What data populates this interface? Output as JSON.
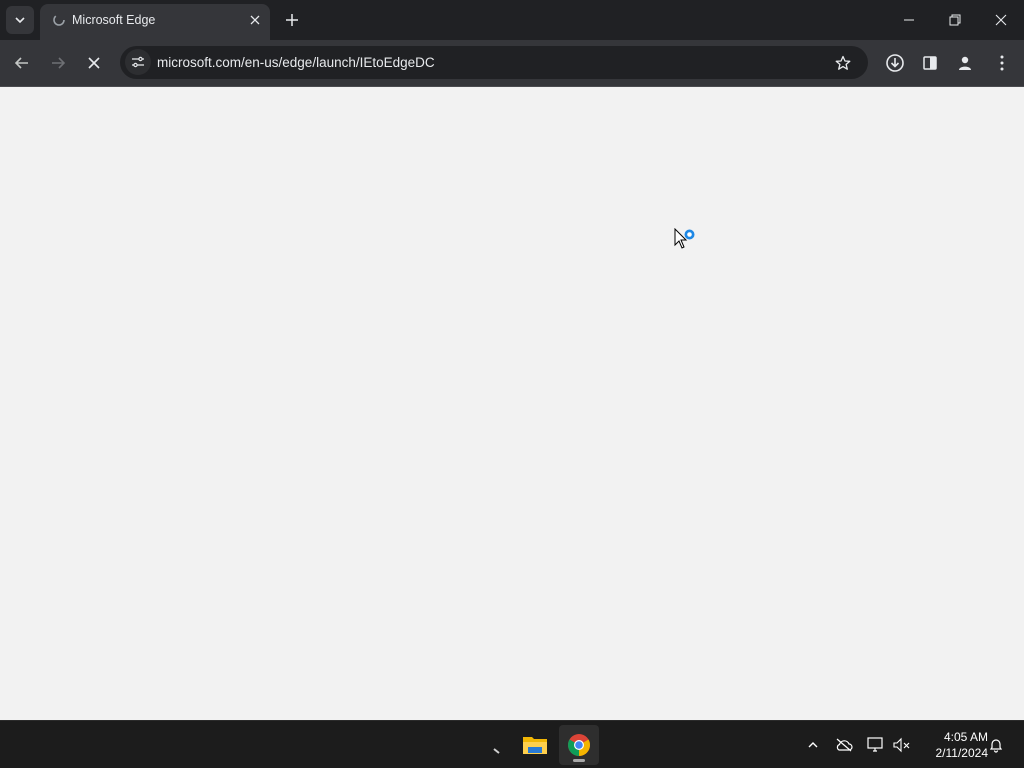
{
  "browser": {
    "tab": {
      "title": "Microsoft Edge"
    },
    "address_bar": {
      "url": "microsoft.com/en-us/edge/launch/IEtoEdgeDC"
    }
  },
  "taskbar": {
    "apps": [
      "file-explorer",
      "google-chrome"
    ],
    "clock": {
      "time": "4:05 AM",
      "date": "2/11/2024"
    }
  },
  "colors": {
    "titlebar": "#202124",
    "toolbar": "#35363a",
    "content": "#f2f2f2",
    "taskbar": "#1c1c1c",
    "busy_cursor_accent": "#1e88e5"
  }
}
